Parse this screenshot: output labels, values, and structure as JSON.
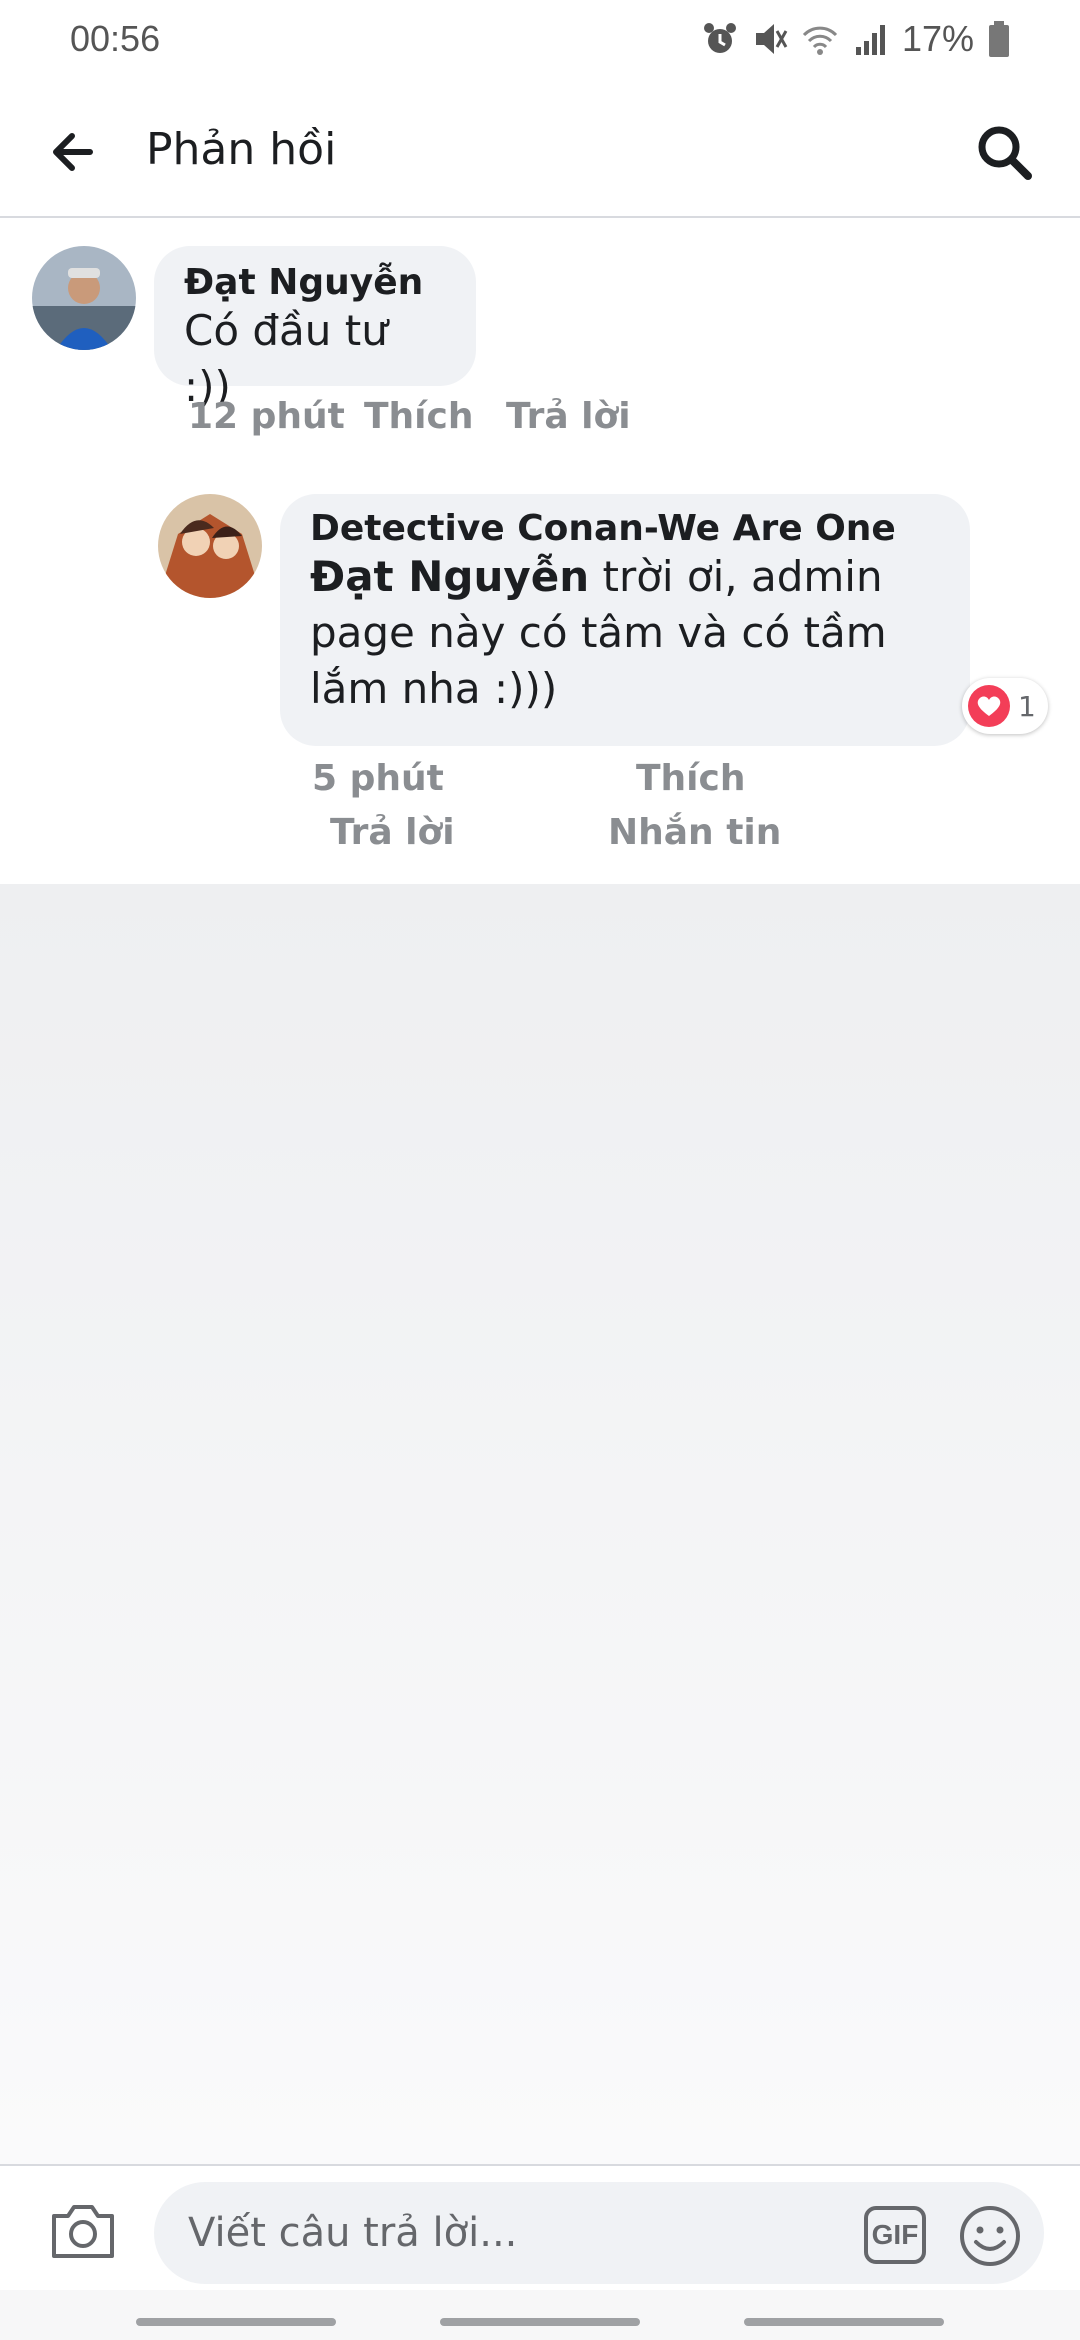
{
  "status_bar": {
    "time": "00:56",
    "battery": "17%",
    "icons": [
      "alarm-icon",
      "mute-icon",
      "wifi-icon",
      "signal-icon",
      "battery-icon"
    ]
  },
  "header": {
    "title": "Phản hồi",
    "back_icon": "arrow-left-icon",
    "search_icon": "search-icon"
  },
  "comments": [
    {
      "author": "Đạt Nguyễn",
      "text": "Có đầu tư :))",
      "time": "12 phút",
      "like_label": "Thích",
      "reply_label": "Trả lời"
    },
    {
      "author": "Detective Conan-We Are One",
      "mention": "Đạt Nguyễn",
      "text": " trời ơi, admin page này có tâm và có tầm lắm nha :)))",
      "time": "5 phút",
      "like_label": "Thích",
      "reply_label": "Trả lời",
      "message_label": "Nhắn tin",
      "reaction_count": "1",
      "reaction_icon": "heart-icon"
    }
  ],
  "composer": {
    "placeholder": "Viết câu trả lời...",
    "gif_label": "GIF",
    "camera_icon": "camera-icon",
    "emoji_icon": "emoji-icon"
  },
  "colors": {
    "bubble": "#f0f2f5",
    "meta_text": "#8a8d91",
    "heart": "#f33e58"
  }
}
